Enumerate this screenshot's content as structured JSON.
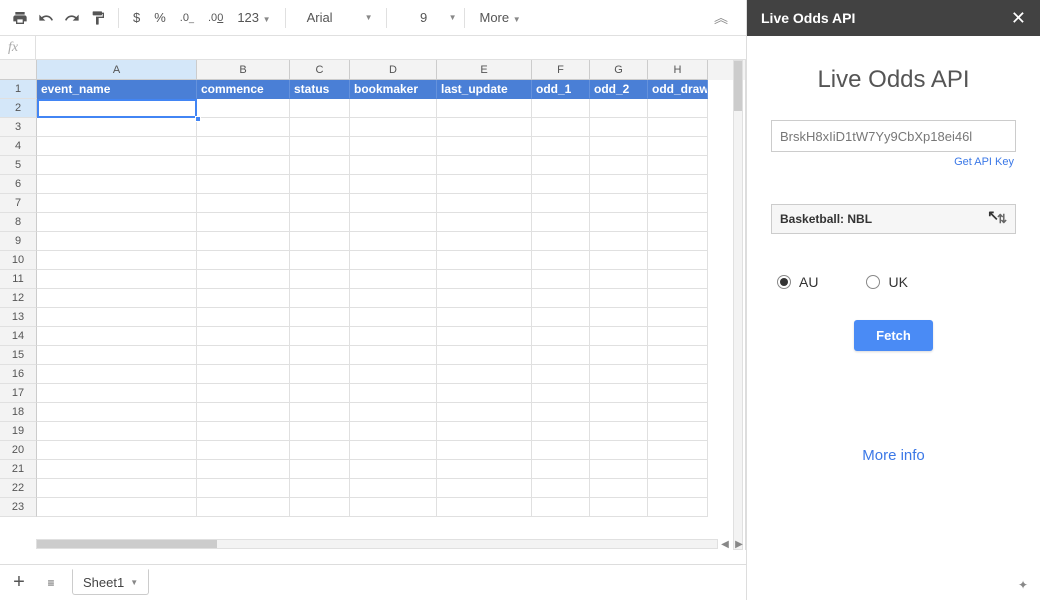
{
  "toolbar": {
    "currency": "$",
    "percent": "%",
    "dec_dec": ".0←",
    "dec_inc": ".00→",
    "format123": "123",
    "font_name": "Arial",
    "font_size": "9",
    "more": "More"
  },
  "fx": {
    "label": "fx",
    "value": ""
  },
  "cols": [
    "A",
    "B",
    "C",
    "D",
    "E",
    "F",
    "G",
    "H"
  ],
  "col_widths": [
    "col-A",
    "col-B",
    "col-C",
    "col-D",
    "col-E",
    "col-F",
    "col-G",
    "col-H"
  ],
  "headers": [
    "event_name",
    "commence",
    "status",
    "bookmaker",
    "last_update",
    "odd_1",
    "odd_2",
    "odd_draw"
  ],
  "row_count": 23,
  "sheet_tab": "Sheet1",
  "sidebar": {
    "header": "Live Odds API",
    "title": "Live Odds API",
    "api_key": "BrskH8xIiD1tW7Yy9CbXp18ei46l",
    "get_key": "Get API Key",
    "sport": "Basketball: NBL",
    "region_au": "AU",
    "region_uk": "UK",
    "fetch": "Fetch",
    "more": "More info"
  }
}
